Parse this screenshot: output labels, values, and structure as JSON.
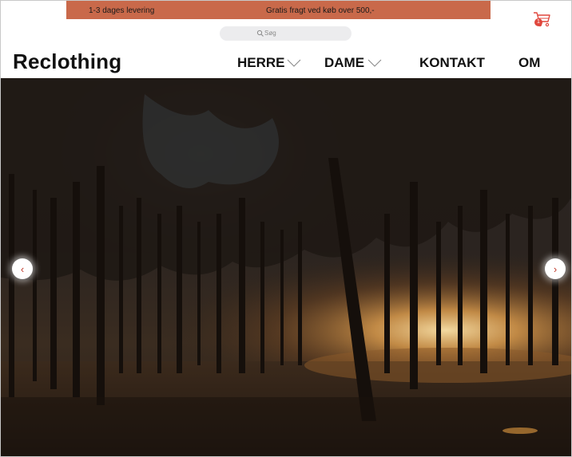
{
  "promo_bar": {
    "delivery_text": "1-3 dages levering",
    "shipping_text": "Gratis fragt ved køb over 500,-",
    "color": "#c9694a"
  },
  "search": {
    "placeholder": "Søg",
    "icon": "search-icon"
  },
  "cart": {
    "icon": "cart-icon",
    "count": "1",
    "badge_color": "#e0473d"
  },
  "brand": {
    "logo_text": "Reclothing"
  },
  "nav": {
    "items": [
      {
        "label": "HERRE",
        "has_dropdown": true
      },
      {
        "label": "DAME",
        "has_dropdown": true
      },
      {
        "label": "KONTAKT",
        "has_dropdown": false
      },
      {
        "label": "OM",
        "has_dropdown": false
      }
    ]
  },
  "hero": {
    "image": "forest at sunset with silhouetted trees",
    "prev_icon": "chevron-left-icon",
    "next_icon": "chevron-right-icon",
    "prev_symbol": "‹",
    "next_symbol": "›"
  }
}
